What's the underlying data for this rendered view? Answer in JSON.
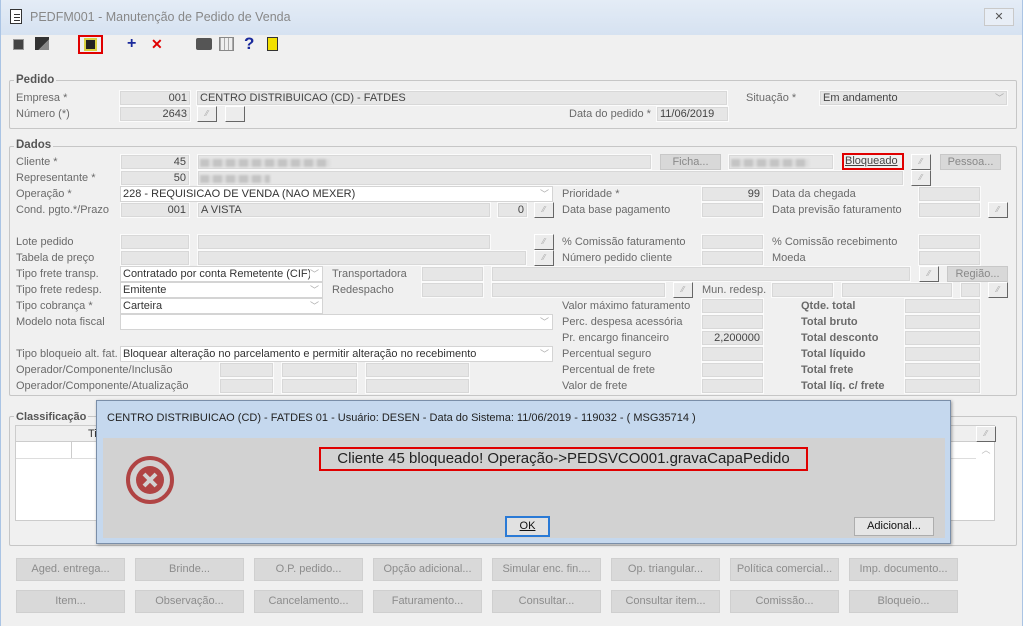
{
  "window": {
    "title": "PEDFM001 - Manutenção de Pedido de Venda",
    "close": "✕"
  },
  "toolbar": {
    "icons": [
      "navigate-icon",
      "window-icon",
      "save-icon",
      "add-icon",
      "delete-icon",
      "print-icon",
      "calendar-icon",
      "help-icon",
      "exit-icon"
    ]
  },
  "pedido": {
    "title": "Pedido",
    "empresa_label": "Empresa *",
    "empresa_code": "001",
    "empresa_name": "CENTRO DISTRIBUICAO (CD) - FATDES",
    "situacao_label": "Situação *",
    "situacao_value": "Em andamento",
    "numero_label": "Número (*)",
    "numero_value": "2643",
    "data_label": "Data do pedido *",
    "data_value": "11/06/2019"
  },
  "dados": {
    "title": "Dados",
    "cliente_label": "Cliente *",
    "cliente_code": "45",
    "ficha": "Ficha...",
    "bloqueado": "Bloqueado",
    "pessoa": "Pessoa...",
    "representante_label": "Representante *",
    "representante_code": "50",
    "operacao_label": "Operação *",
    "operacao_value": "228 - REQUISICAO DE VENDA (NAO MEXER)",
    "cond_label": "Cond. pgto.*/Prazo",
    "cond_code": "001",
    "cond_name": "A VISTA",
    "prazo": "0",
    "lote_label": "Lote pedido",
    "tabela_label": "Tabela de preço",
    "frete_transp_label": "Tipo frete transp.",
    "frete_transp_value": "Contratado por conta Remetente (CIF)",
    "frete_redesp_label": "Tipo frete redesp.",
    "frete_redesp_value": "Emitente",
    "cobranca_label": "Tipo cobrança *",
    "cobranca_value": "Carteira",
    "modelo_label": "Modelo nota fiscal",
    "modelo_value": "",
    "bloqueio_label": "Tipo bloqueio alt. fat.",
    "bloqueio_value": "Bloquear alteração no parcelamento e permitir alteração no recebimento",
    "op_inclusao_label": "Operador/Componente/Inclusão",
    "op_atualizacao_label": "Operador/Componente/Atualização",
    "transportadora_label": "Transportadora",
    "regiao": "Região...",
    "redespacho_label": "Redespacho",
    "mun_redesp_label": "Mun. redesp.",
    "prioridade_label": "Prioridade *",
    "prioridade_value": "99",
    "data_base_label": "Data base pagamento",
    "comissao_fat_label": "% Comissão faturamento",
    "num_ped_cli_label": "Número pedido cliente",
    "valor_max_label": "Valor máximo faturamento",
    "perc_desp_label": "Perc. despesa acessória",
    "encargo_label": "Pr. encargo financeiro",
    "encargo_value": "2,200000",
    "perc_seguro_label": "Percentual seguro",
    "perc_frete_label": "Percentual de frete",
    "valor_frete_label": "Valor de frete",
    "data_chegada_label": "Data da chegada",
    "data_prev_label": "Data previsão faturamento",
    "comissao_rec_label": "% Comissão recebimento",
    "moeda_label": "Moeda",
    "qtde_total": "Qtde. total",
    "total_bruto": "Total bruto",
    "total_desconto": "Total desconto",
    "total_liquido": "Total líquido",
    "total_frete": "Total frete",
    "total_liq_frete": "Total líq. c/ frete"
  },
  "classificacao": {
    "title": "Classificação",
    "col1": "Ti"
  },
  "dialog": {
    "title": "CENTRO DISTRIBUICAO (CD) - FATDES 01 - Usuário: DESEN - Data do Sistema: 11/06/2019 - 119032 - ( MSG35714 )",
    "message": "Cliente 45 bloqueado! Operação->PEDSVCO001.gravaCapaPedido",
    "ok": "OK",
    "adicional": "Adicional...",
    "icon": "error-icon",
    "accent": "#b04444"
  },
  "buttons_row1": [
    "Aged. entrega...",
    "Brinde...",
    "O.P. pedido...",
    "Opção adicional...",
    "Simular enc. fin....",
    "Op. triangular...",
    "Política comercial...",
    "Imp. documento..."
  ],
  "buttons_row2": [
    "Item...",
    "Observação...",
    "Cancelamento...",
    "Faturamento...",
    "Consultar...",
    "Consultar item...",
    "Comissão...",
    "Bloqueio..."
  ]
}
